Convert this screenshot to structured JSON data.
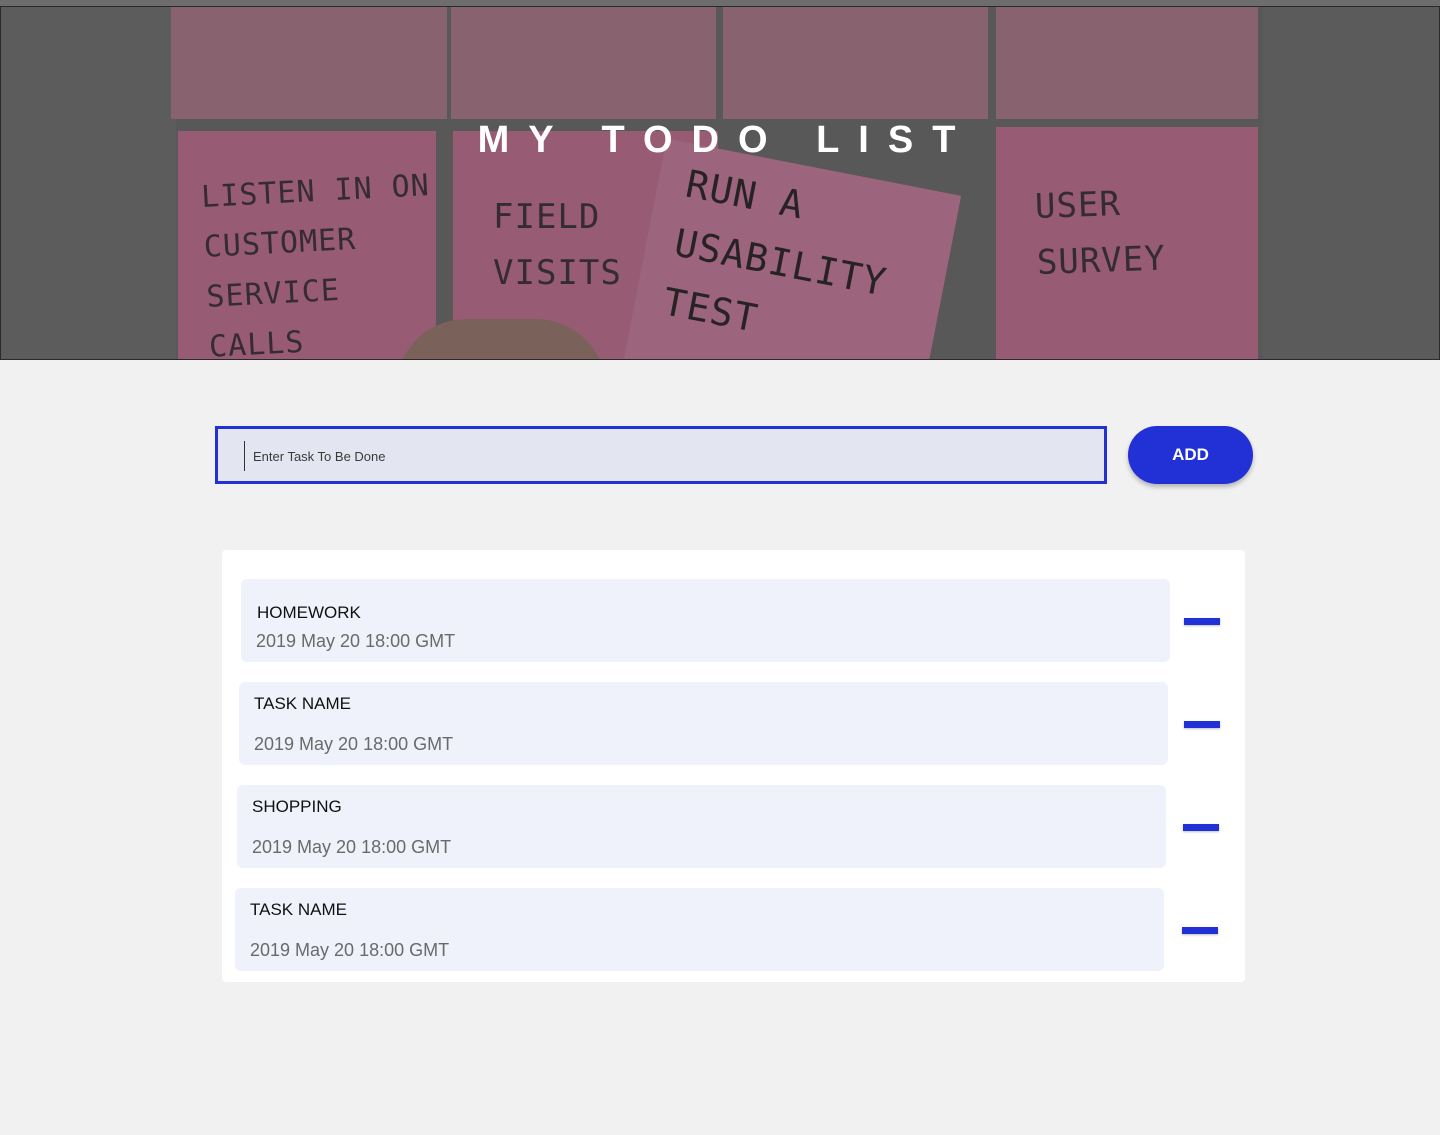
{
  "header": {
    "title": "MY TODO LIST",
    "image_notes": [
      "LISTEN IN ON CUSTOMER SERVICE CALLS",
      "FIELD VISITS",
      "RUN A USABILITY TEST",
      "USER SURVEY"
    ]
  },
  "input": {
    "placeholder": "Enter Task To Be Done",
    "value": "",
    "add_label": "ADD"
  },
  "tasks": [
    {
      "name": "HOMEWORK",
      "date": "2019 May 20 18:00 GMT"
    },
    {
      "name": "TASK NAME",
      "date": "2019 May 20 18:00 GMT"
    },
    {
      "name": "SHOPPING",
      "date": "2019 May 20 18:00 GMT"
    },
    {
      "name": "TASK NAME",
      "date": "2019 May 20 18:00 GMT"
    }
  ],
  "colors": {
    "accent": "#2231d6",
    "background": "#f1f1f1",
    "card": "#f0f2fb",
    "input_bg": "#e3e6f0"
  },
  "icons": {
    "remove": "minus-icon"
  }
}
